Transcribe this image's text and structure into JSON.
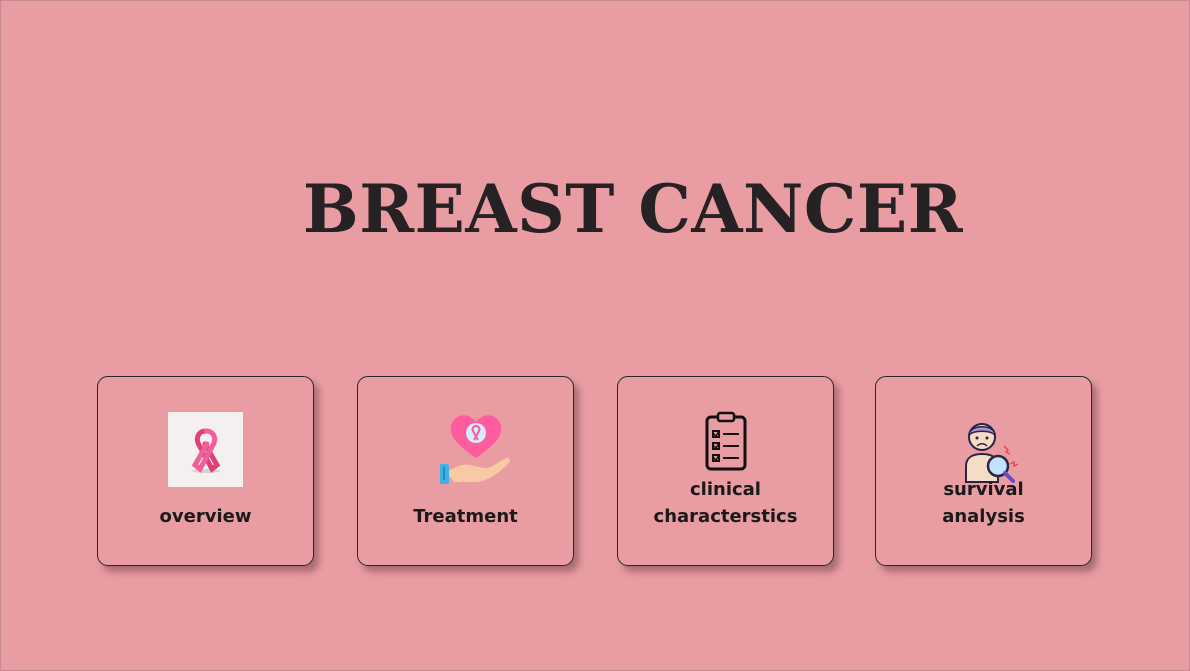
{
  "title": "BREAST CANCER",
  "colors": {
    "background": "#e99ca2",
    "title": "#262122",
    "ribbon": "#e0407a",
    "heart": "#ff5c9d"
  },
  "cards": [
    {
      "label": "overview",
      "icon": "pink-ribbon-icon"
    },
    {
      "label": "Treatment",
      "icon": "heart-hand-icon"
    },
    {
      "label_line1": "clinical",
      "label_line2": "characterstics",
      "icon": "clipboard-checklist-icon"
    },
    {
      "label_line1": "survival",
      "label_line2": "analysis",
      "icon": "patient-magnifier-icon"
    }
  ]
}
